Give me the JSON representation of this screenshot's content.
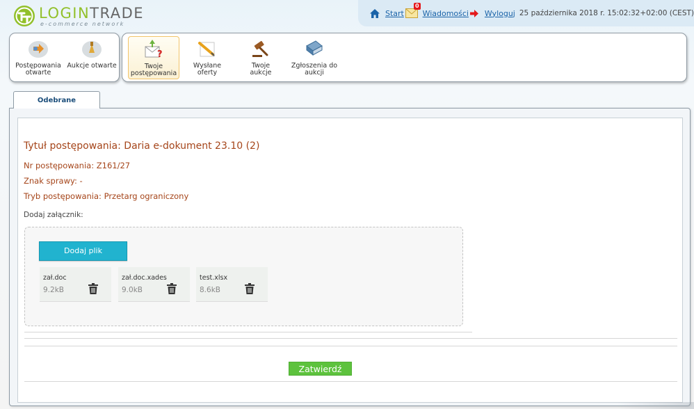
{
  "logo": {
    "brand_part1": "LOGIN",
    "brand_part2": "TRADE",
    "tagline": "e-commerce network",
    "icon": "logintrade-logo"
  },
  "topbar": {
    "start_label": "Start",
    "start_icon": "home-icon",
    "messages_label": "Wiadomości",
    "messages_icon": "envelope-icon",
    "messages_count": "0",
    "logout_label": "Wyloguj",
    "logout_icon": "red-arrow-icon",
    "datetime": "25 października 2018 r. 15:02:32+02:00 (CEST)"
  },
  "toolbar_left": [
    {
      "label_line1": "Postępowania",
      "label_line2": "otwarte",
      "icon": "tenders-open-icon"
    },
    {
      "label_line1": "Aukcje otwarte",
      "label_line2": "",
      "icon": "auctions-open-icon"
    }
  ],
  "toolbar_right": [
    {
      "label_line1": "Twoje",
      "label_line2": "postępowania",
      "icon": "my-tenders-icon",
      "active": true
    },
    {
      "label_line1": "Wysłane",
      "label_line2": "oferty",
      "icon": "sent-offers-icon",
      "active": false
    },
    {
      "label_line1": "Twoje",
      "label_line2": "aukcje",
      "icon": "gavel-icon",
      "active": false
    },
    {
      "label_line1": "Zgłoszenia do",
      "label_line2": "aukcji",
      "icon": "book-icon",
      "active": false
    }
  ],
  "tab": {
    "label": "Odebrane"
  },
  "tender": {
    "title": "Tytuł postępowania: Daria e-dokument 23.10 (2)",
    "number": "Nr postępowania: Z161/27",
    "case_mark": "Znak sprawy: -",
    "mode": "Tryb postępowania: Przetarg ograniczony"
  },
  "attachments": {
    "label": "Dodaj załącznik:",
    "add_button": "Dodaj plik",
    "files": [
      {
        "name": "zał.doc",
        "size": "9.2kB"
      },
      {
        "name": "zał.doc.xades",
        "size": "9.0kB"
      },
      {
        "name": "test.xlsx",
        "size": "8.6kB"
      }
    ]
  },
  "submit_label": "Zatwierdź",
  "colors": {
    "accent_orange": "#a5451a",
    "button_cyan": "#21b3cf",
    "button_green": "#5dc23d",
    "link_blue": "#1a63a8",
    "brand_green": "#92c02a"
  }
}
